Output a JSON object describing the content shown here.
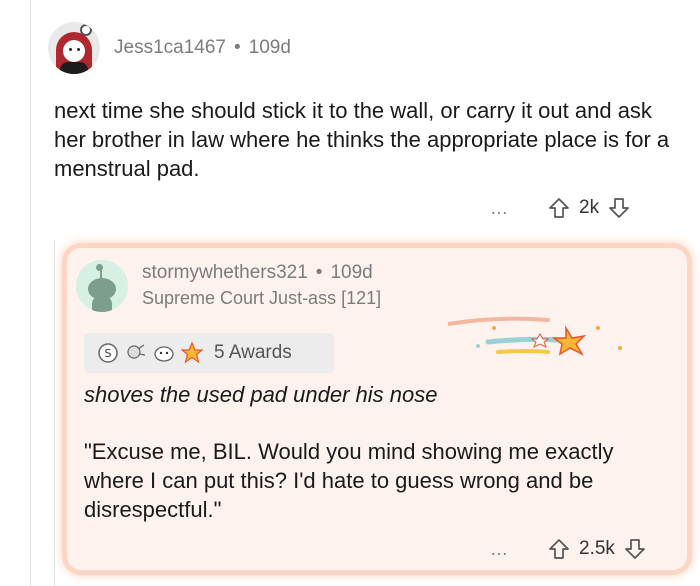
{
  "parent_comment": {
    "username": "Jess1ca1467",
    "age": "109d",
    "body": "next time she should stick it to the wall, or carry it out and ask her brother in law where he thinks the appropriate place is for a menstrual pad.",
    "score": "2k",
    "more_label": "…"
  },
  "reply": {
    "username": "stormywhethers321",
    "age": "109d",
    "flair": "Supreme Court Just-ass [121]",
    "awards_label": "5 Awards",
    "body_italic": "shoves the used pad under his nose",
    "body_quote": "\"Excuse me, BIL. Would you mind showing me exactly where I can put this? I'd hate to guess wrong and be disrespectful.\"",
    "score": "2.5k",
    "more_label": "…"
  },
  "separator": "•",
  "colors": {
    "reply_bg": "#fdf2ed",
    "reply_glow": "#fbd6c4",
    "meta_text": "#7c7c7c"
  },
  "icons": [
    "avatar-jessica",
    "avatar-snoo",
    "upvote-icon",
    "downvote-icon",
    "more-icon",
    "award-icon"
  ]
}
